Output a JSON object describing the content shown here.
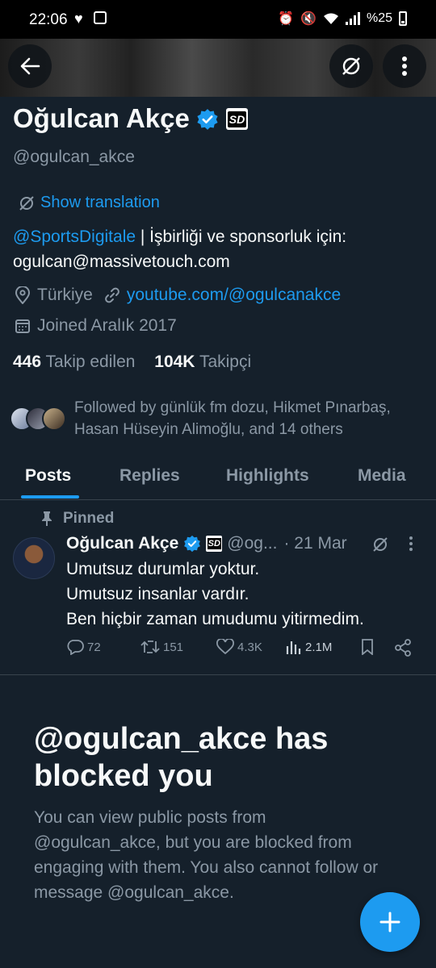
{
  "status_bar": {
    "time": "22:06",
    "battery": "%25"
  },
  "profile": {
    "display_name": "Oğulcan Akçe",
    "badge_text": "SD",
    "handle": "@ogulcan_akce",
    "show_translation": "Show translation",
    "bio_mention": "@SportsDigitale",
    "bio_rest": " | İşbirliği ve sponsorluk için: ogulcan@massivetouch.com",
    "location": "Türkiye",
    "website": "youtube.com/@ogulcanakce",
    "joined": "Joined Aralık 2017",
    "following_count": "446",
    "following_label": "Takip edilen",
    "followers_count": "104K",
    "followers_label": "Takipçi",
    "followed_by": "Followed by günlük fm dozu, Hikmet Pınarbaş, Hasan Hüseyin Alimoğlu, and 14 others"
  },
  "tabs": [
    {
      "label": "Posts",
      "active": true
    },
    {
      "label": "Replies",
      "active": false
    },
    {
      "label": "Highlights",
      "active": false
    },
    {
      "label": "Media",
      "active": false
    }
  ],
  "post": {
    "pinned_label": "Pinned",
    "author": "Oğulcan Akçe",
    "badge_text": "SD",
    "handle": "@og...",
    "date": "· 21 Mar",
    "lines": [
      "Umutsuz durumlar yoktur.",
      "Umutsuz insanlar vardır.",
      "Ben hiçbir zaman umudumu yitirmedim."
    ],
    "replies": "72",
    "reposts": "151",
    "likes": "4.3K",
    "views": "2.1M"
  },
  "blocked": {
    "title": "@ogulcan_akce has blocked you",
    "text": "You can view public posts from @ogulcan_akce, but you are blocked from engaging with them. You also cannot follow or message @ogulcan_akce."
  },
  "colors": {
    "background": "#15202b",
    "accent": "#1d9bf0",
    "muted": "#8b98a5",
    "divider": "#38444d"
  }
}
